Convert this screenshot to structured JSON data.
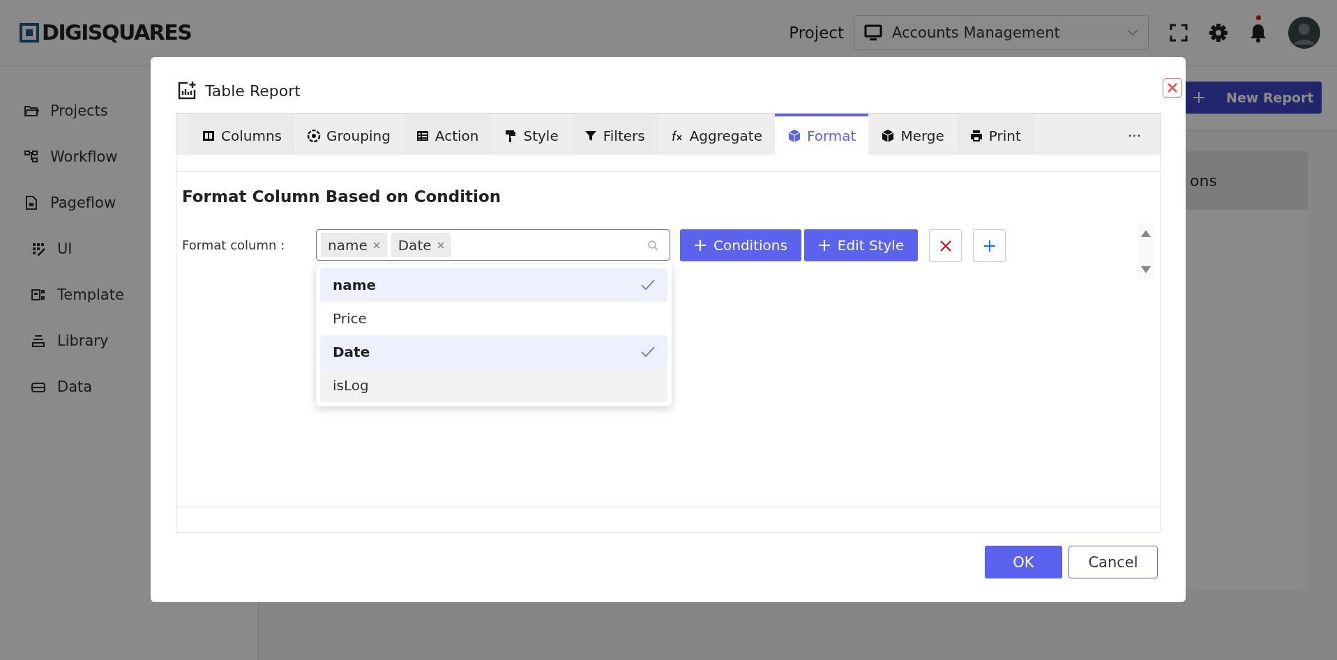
{
  "header": {
    "logo": "DIGISQUARES",
    "project_label": "Project",
    "project_select": {
      "value": "Accounts Management"
    },
    "notification": true
  },
  "sidebar": {
    "items": [
      {
        "label": "Projects"
      },
      {
        "label": "Workflow"
      },
      {
        "label": "Pageflow"
      },
      {
        "label": "UI"
      },
      {
        "label": "Template"
      },
      {
        "label": "Library"
      },
      {
        "label": "Data"
      }
    ]
  },
  "background": {
    "new_report_button": "New Report",
    "card_header": "ons"
  },
  "dialog": {
    "title": "Table Report",
    "tabs": [
      {
        "label": "Columns",
        "selected": false
      },
      {
        "label": "Grouping",
        "selected": false
      },
      {
        "label": "Action",
        "selected": false
      },
      {
        "label": "Style",
        "selected": false
      },
      {
        "label": "Filters",
        "selected": false
      },
      {
        "label": "Aggregate",
        "selected": false
      },
      {
        "label": "Format",
        "selected": true
      },
      {
        "label": "Merge",
        "selected": false
      },
      {
        "label": "Print",
        "selected": false
      },
      {
        "label": "···",
        "selected": false
      }
    ],
    "heading": "Format Column Based on Condition",
    "format_label": "Format column :",
    "chips": [
      {
        "label": "name"
      },
      {
        "label": "Date"
      }
    ],
    "buttons": [
      "Conditions",
      "Edit Style"
    ],
    "dropdown": [
      {
        "label": "name",
        "selected": true,
        "highlighted": false
      },
      {
        "label": "Price",
        "selected": false,
        "highlighted": false
      },
      {
        "label": "Date",
        "selected": true,
        "highlighted": false
      },
      {
        "label": "isLog",
        "selected": false,
        "highlighted": true
      }
    ],
    "ok": "OK",
    "cancel": "Cancel"
  }
}
